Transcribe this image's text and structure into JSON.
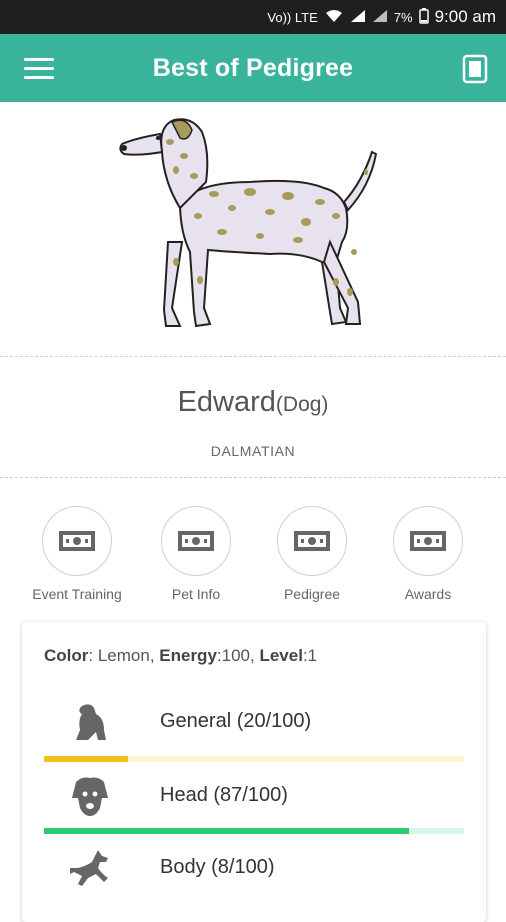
{
  "statusbar": {
    "volte": "Vo)) LTE",
    "battery_pct": "7%",
    "time": "9:00 am"
  },
  "appbar": {
    "title": "Best of Pedigree",
    "menu_icon": "hamburger-menu-icon",
    "right_icon": "document-icon"
  },
  "pet": {
    "name": "Edward",
    "kind": "(Dog)",
    "breed": "DALMATIAN"
  },
  "actions": [
    {
      "label": "Event Training",
      "icon": "money-icon"
    },
    {
      "label": "Pet Info",
      "icon": "money-icon"
    },
    {
      "label": "Pedigree",
      "icon": "money-icon"
    },
    {
      "label": "Awards",
      "icon": "money-icon"
    }
  ],
  "stats": {
    "color_key": "Color",
    "color_value": ": Lemon, ",
    "energy_key": "Energy",
    "energy_value": ":100, ",
    "level_key": "Level",
    "level_value": ":1",
    "rows": [
      {
        "label": "General (20/100)",
        "value": 20,
        "max": 100,
        "icon": "sitting-dog-icon",
        "color": "#f2c21b",
        "track": "#fbf3d4"
      },
      {
        "label": "Head (87/100)",
        "value": 87,
        "max": 100,
        "icon": "dog-head-icon",
        "color": "#2ecc71",
        "track": "#d9f7e6"
      },
      {
        "label": "Body (8/100)",
        "value": 8,
        "max": 100,
        "icon": "running-dog-icon",
        "color": "#e74c3c",
        "track": "#fbe0dd"
      }
    ]
  },
  "colors": {
    "appbar": "#39b39a",
    "statusbar": "#1f1f1f"
  }
}
